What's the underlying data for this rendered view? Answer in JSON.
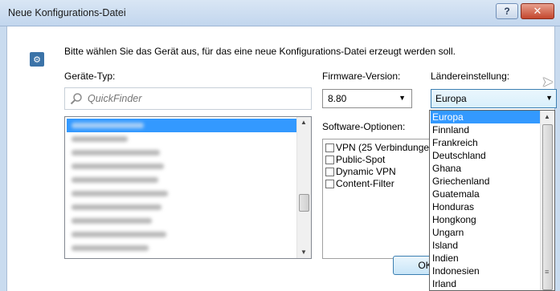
{
  "window": {
    "title": "Neue Konfigurations-Datei",
    "help_label": "?",
    "close_label": "✕"
  },
  "dialog": {
    "intro_text": "Bitte wählen Sie das Gerät aus, für das eine neue Konfigurations-Datei erzeugt werden soll.",
    "geraete_typ_label": "Geräte-Typ:",
    "quickfinder_placeholder": "QuickFinder",
    "firmware_label": "Firmware-Version:",
    "firmware_value": "8.80",
    "laender_label": "Ländereinstellung:",
    "laender_value": "Europa",
    "software_label": "Software-Optionen:",
    "software_options": [
      {
        "label": "VPN (25 Verbindungen)",
        "checked": false
      },
      {
        "label": "Public-Spot",
        "checked": false
      },
      {
        "label": "Dynamic VPN",
        "checked": false
      },
      {
        "label": "Content-Filter",
        "checked": false
      }
    ],
    "ok_label": "OK"
  },
  "country_dropdown": {
    "selected": "Europa",
    "items": [
      "Europa",
      "Finnland",
      "Frankreich",
      "Deutschland",
      "Ghana",
      "Griechenland",
      "Guatemala",
      "Honduras",
      "Hongkong",
      "Ungarn",
      "Island",
      "Indien",
      "Indonesien",
      "Irland"
    ]
  },
  "device_list": {
    "selected_index": 0,
    "blurred": true
  },
  "colors": {
    "selection": "#3399ff",
    "title_bar": "#c9dbef",
    "close_button": "#c4472e"
  },
  "icons": [
    "app-icon",
    "search-icon",
    "chevron-down-icon",
    "mouse-cursor-icon",
    "scroll-up-icon",
    "scroll-down-icon"
  ]
}
